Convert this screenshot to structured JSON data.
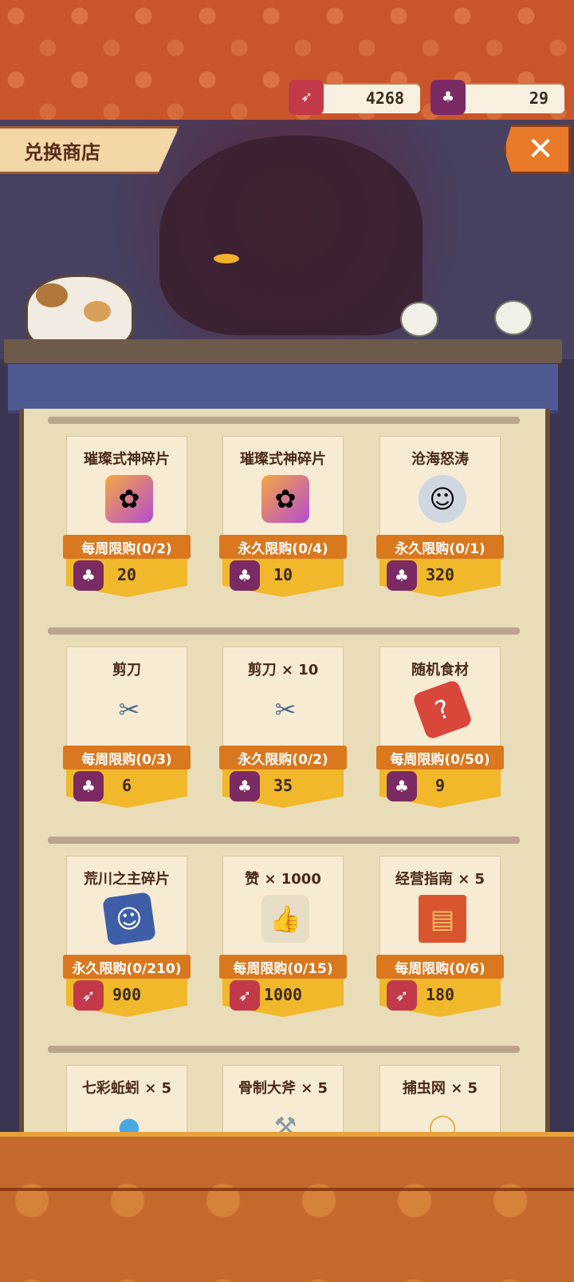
{
  "currencies": [
    {
      "icon": "feather-icon",
      "value": "4268"
    },
    {
      "icon": "clover-charm-icon",
      "value": "29"
    }
  ],
  "shop": {
    "title": "兑换商店",
    "close_icon": "close-icon"
  },
  "items": [
    {
      "name": "璀璨式神碎片",
      "limit": "每周限购(0/2)",
      "price": "20",
      "currency_icon": "clover-charm-icon"
    },
    {
      "name": "璀璨式神碎片",
      "limit": "永久限购(0/4)",
      "price": "10",
      "currency_icon": "clover-charm-icon"
    },
    {
      "name": "沧海怒涛",
      "limit": "永久限购(0/1)",
      "price": "320",
      "currency_icon": "clover-charm-icon"
    },
    {
      "name": "剪刀",
      "limit": "每周限购(0/3)",
      "price": "6",
      "currency_icon": "clover-charm-icon"
    },
    {
      "name": "剪刀 × 10",
      "limit": "永久限购(0/2)",
      "price": "35",
      "currency_icon": "clover-charm-icon"
    },
    {
      "name": "随机食材",
      "limit": "每周限购(0/50)",
      "price": "9",
      "currency_icon": "clover-charm-icon"
    },
    {
      "name": "荒川之主碎片",
      "limit": "永久限购(0/210)",
      "price": "900",
      "currency_icon": "feather-icon"
    },
    {
      "name": "赞 × 1000",
      "limit": "每周限购(0/15)",
      "price": "1000",
      "currency_icon": "feather-icon"
    },
    {
      "name": "经营指南 × 5",
      "limit": "每周限购(0/6)",
      "price": "180",
      "currency_icon": "feather-icon"
    },
    {
      "name": "七彩蚯蚓 × 5"
    },
    {
      "name": "骨制大斧 × 5"
    },
    {
      "name": "捕虫网 × 5"
    }
  ],
  "colors": {
    "banner": "#c9552a",
    "limit_tag": "#d9781f",
    "price_tag": "#f1b82b",
    "feather": "#c23a4a",
    "clover": "#7b2a63"
  }
}
